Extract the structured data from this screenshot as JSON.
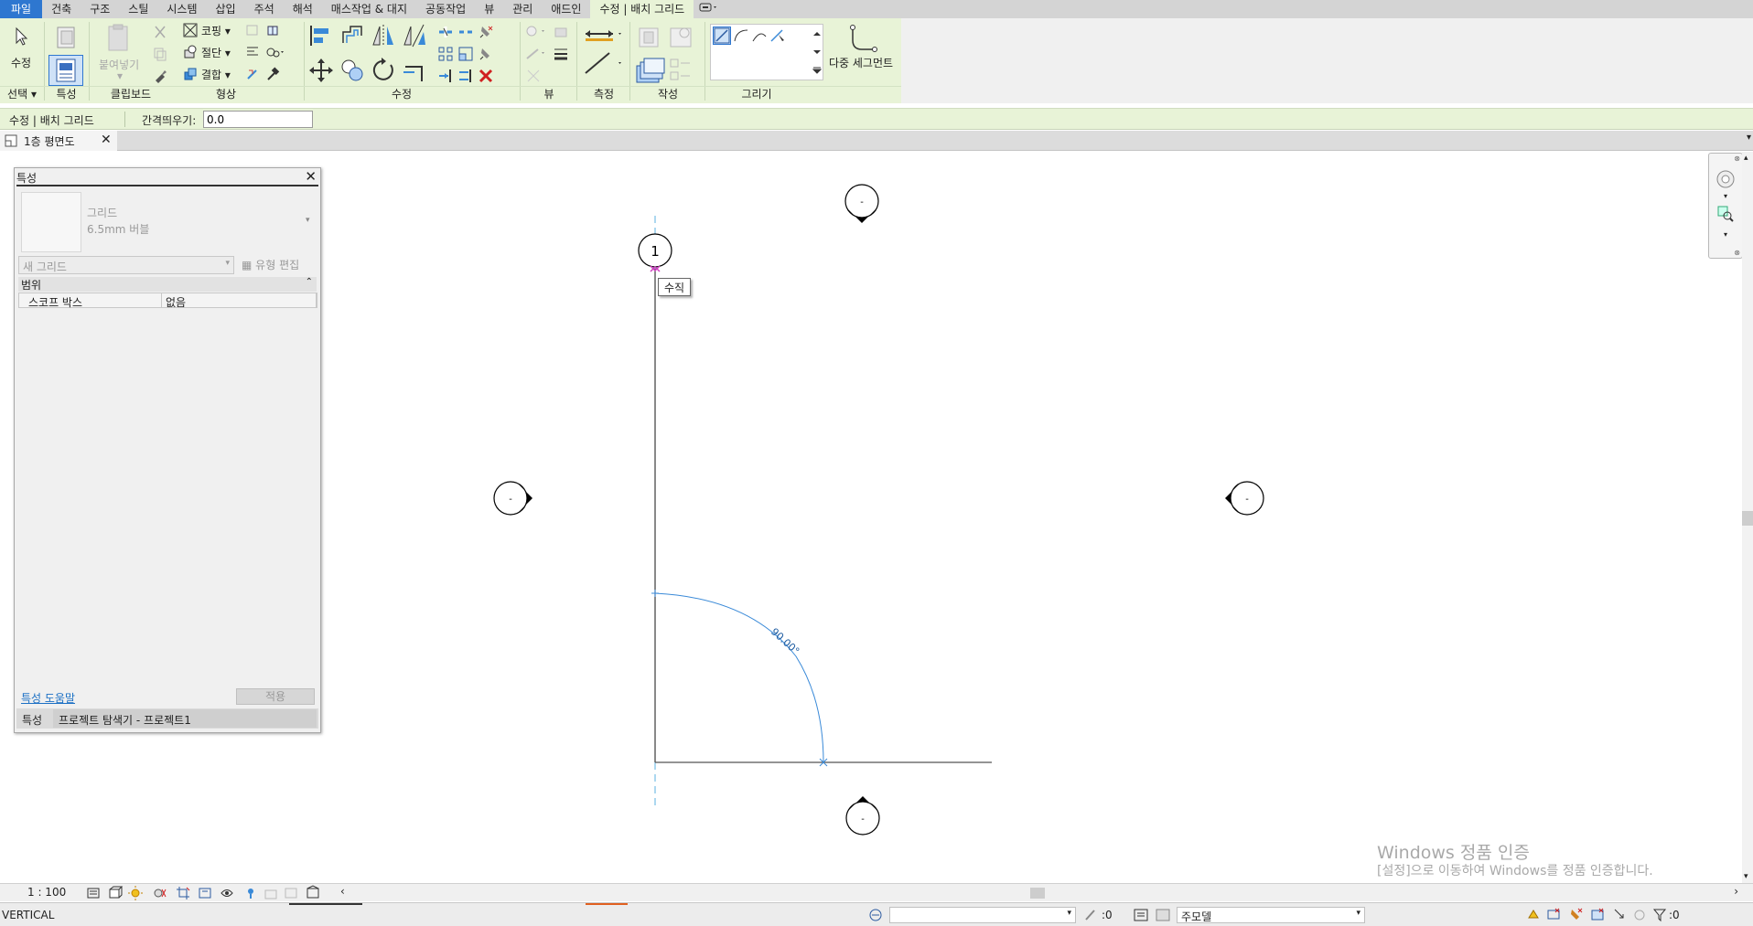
{
  "menu": {
    "items": [
      "파일",
      "건축",
      "구조",
      "스틸",
      "시스템",
      "삽입",
      "주석",
      "해석",
      "매스작업 & 대지",
      "공동작업",
      "뷰",
      "관리",
      "애드인",
      "수정 | 배치 그리드"
    ]
  },
  "ribbon": {
    "groups": {
      "select": "선택",
      "properties": "특성",
      "clipboard": "클립보드",
      "geometry": "형상",
      "modify": "수정",
      "view": "뷰",
      "measure": "측정",
      "create": "작성",
      "draw": "그리기"
    },
    "modify_button": "수정",
    "paste_button": "붙여넣기",
    "cope_label": "코핑",
    "cut_label": "절단",
    "join_label": "결합",
    "multi_segment": "다중 세그먼트"
  },
  "options_bar": {
    "context_label": "수정 | 배치 그리드",
    "offset_label": "간격띄우기:",
    "offset_value": "0.0"
  },
  "view_tab": {
    "label": "1층 평면도"
  },
  "properties": {
    "title": "특성",
    "type_name": "그리드",
    "type_sub": "6.5mm 버블",
    "instance_selector": "새 그리드",
    "edit_type": "유형 편집",
    "section": "범위",
    "rows": [
      {
        "key": "스코프 박스",
        "value": "없음"
      }
    ],
    "help_link": "특성 도움말",
    "apply_button": "적용",
    "tab_properties": "특성",
    "tab_browser": "프로젝트 탐색기 - 프로젝트1"
  },
  "canvas": {
    "grid_bubble_label": "1",
    "tooltip": "수직",
    "angle_label": "90.00°",
    "elevation_marker_label": "-"
  },
  "view_control": {
    "scale": "1 : 100"
  },
  "status_bar": {
    "text": "VERTICAL",
    "workset_count": ":0",
    "model_dropdown": "주모델",
    "filter_count": ":0"
  },
  "watermark": {
    "line1": "Windows 정품 인증",
    "line2": "[설정]으로 이동하여 Windows를 정품 인증합니다."
  },
  "colors": {
    "menu_active": "#2e77d0",
    "ribbon_context": "#e8f3d7",
    "sketch_blue": "#3a8ad8",
    "highlight_magenta": "#d040c0"
  }
}
